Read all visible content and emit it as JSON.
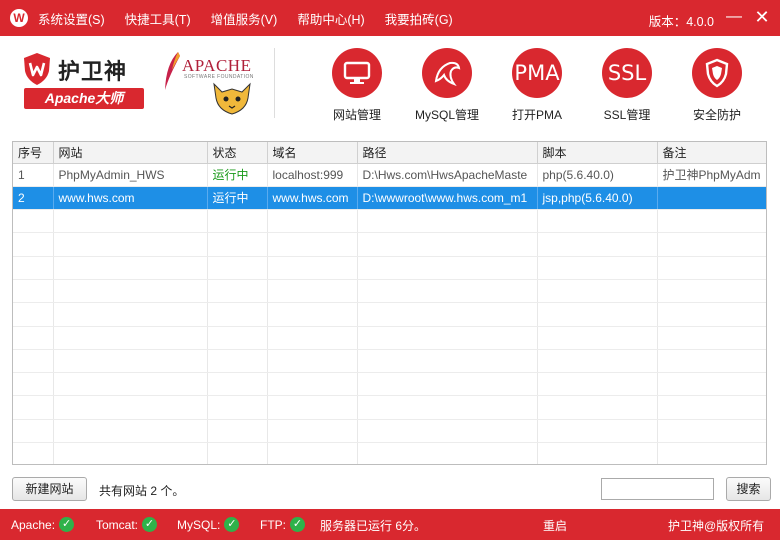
{
  "titlebar": {
    "logo_letter": "W",
    "menu": [
      "系统设置(S)",
      "快捷工具(T)",
      "增值服务(V)",
      "帮助中心(H)",
      "我要拍砖(G)"
    ],
    "version": "版本：4.0.0",
    "minimize": "—",
    "close": "✕"
  },
  "brand": {
    "name": "护卫神",
    "badge": "Apache大师",
    "apache_text": "APACHE",
    "apache_sub": "SOFTWARE FOUNDATION"
  },
  "tools": [
    {
      "label": "网站管理",
      "icon": "monitor-icon"
    },
    {
      "label": "MySQL管理",
      "icon": "dolphin-icon"
    },
    {
      "label": "打开PMA",
      "icon_text": "PMA"
    },
    {
      "label": "SSL管理",
      "icon_text": "SSL"
    },
    {
      "label": "安全防护",
      "icon": "shield-icon"
    }
  ],
  "table": {
    "columns": [
      "序号",
      "网站",
      "状态",
      "域名",
      "路径",
      "脚本",
      "备注"
    ],
    "rows": [
      [
        "1",
        "PhpMyAdmin_HWS",
        "运行中",
        "localhost:999",
        "D:\\Hws.com\\HwsApacheMaste",
        "php(5.6.40.0)",
        "护卫神PhpMyAdm"
      ],
      [
        "2",
        "www.hws.com",
        "运行中",
        "www.hws.com",
        "D:\\wwwroot\\www.hws.com_m1",
        "jsp,php(5.6.40.0)",
        ""
      ]
    ],
    "selected_row": 2
  },
  "bottom": {
    "new_site": "新建网站",
    "count_text": "共有网站 2 个。",
    "search_value": "",
    "search_button": "搜索"
  },
  "statusbar": {
    "apache": "Apache:",
    "tomcat": "Tomcat:",
    "mysql": "MySQL:",
    "ftp": "FTP:",
    "uptime": "服务器已运行 6分。",
    "restart": "重启",
    "copyright": "护卫神@版权所有",
    "ok_color": "#2fb24a"
  },
  "colors": {
    "accent": "#d9282f",
    "selection": "#1e8fe6",
    "running": "#1a9a1a"
  }
}
